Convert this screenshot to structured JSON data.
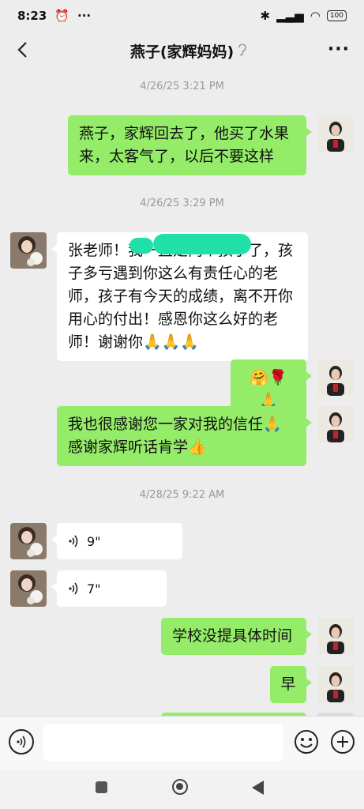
{
  "status": {
    "time": "8:23",
    "battery": "100"
  },
  "header": {
    "title": "燕子(家辉妈妈)"
  },
  "timestamps": [
    "4/26/25 3:21 PM",
    "4/26/25 3:29 PM",
    "4/28/25 9:22 AM"
  ],
  "messages": {
    "m1": "燕子，家辉回去了，他买了水果来，太客气了，以后不要这样",
    "m2": "张老师！我一直是两个孩子了，孩子多亏遇到你这么有责任心的老师，孩子有今天的成绩，离不开你用心的付出！感恩你这么好的老师！谢谢你🙏🙏🙏",
    "m3": "🤗🌹🙏",
    "m4": "我也很感谢您一家对我的信任🙏感谢家辉听话肯学👍",
    "v1": "9\"",
    "v2": "7\"",
    "m5": "学校没提具体时间",
    "m6": "早"
  },
  "icons": {
    "voice": "voice-input-icon",
    "emoji": "emoji-icon",
    "plus": "plus-icon"
  },
  "colors": {
    "sent_bubble": "#95ec69",
    "received_bubble": "#ffffff",
    "background": "#ededed"
  }
}
